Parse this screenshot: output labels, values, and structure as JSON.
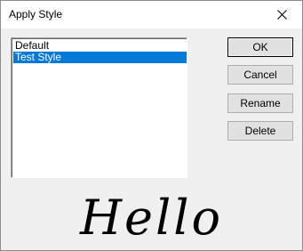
{
  "window": {
    "title": "Apply Style"
  },
  "style_list": {
    "items": [
      {
        "label": "Default",
        "selected": false
      },
      {
        "label": "Test Style",
        "selected": true
      }
    ]
  },
  "buttons": {
    "ok": "OK",
    "cancel": "Cancel",
    "rename": "Rename",
    "delete": "Delete"
  },
  "preview": {
    "text": "Hello"
  },
  "colors": {
    "selection": "#0078d7",
    "dialog_bg": "#f0f0f0"
  }
}
